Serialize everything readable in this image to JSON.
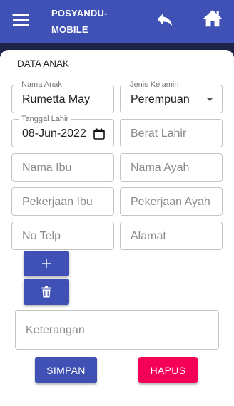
{
  "header": {
    "title_line1": "POSYANDU-",
    "title_line2": "MOBILE"
  },
  "form": {
    "section_title": "DATA ANAK",
    "nama_anak": {
      "label": "Nama Anak",
      "value": "Rumetta May"
    },
    "jenis_kelamin": {
      "label": "Jenis Kelamin",
      "value": "Perempuan"
    },
    "tanggal_lahir": {
      "label": "Tanggal Lahir",
      "value": "08-Jun-2022"
    },
    "berat_lahir": {
      "placeholder": "Berat Lahir"
    },
    "nama_ibu": {
      "placeholder": "Nama Ibu"
    },
    "nama_ayah": {
      "placeholder": "Nama Ayah"
    },
    "pekerjaan_ibu": {
      "placeholder": "Pekerjaan Ibu"
    },
    "pekerjaan_ayah": {
      "placeholder": "Pekerjaan Ayah"
    },
    "no_telp": {
      "placeholder": "No Telp"
    },
    "alamat": {
      "placeholder": "Alamat"
    },
    "keterangan": {
      "placeholder": "Keterangan"
    }
  },
  "buttons": {
    "add_icon": "plus-icon",
    "delete_icon": "trash-icon",
    "simpan": "SIMPAN",
    "hapus": "HAPUS"
  },
  "colors": {
    "primary": "#3f51b5",
    "accent": "#f50057"
  }
}
